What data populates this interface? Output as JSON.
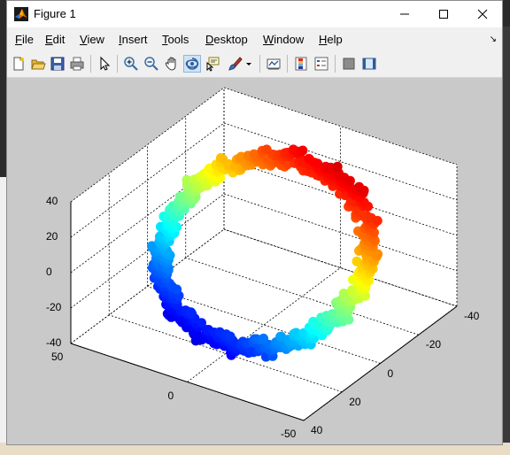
{
  "window": {
    "title": "Figure 1",
    "controls": {
      "minimize": "minimize",
      "maximize": "maximize",
      "close": "close"
    }
  },
  "menu": {
    "items": [
      {
        "label_first": "F",
        "label_rest": "ile"
      },
      {
        "label_first": "E",
        "label_rest": "dit"
      },
      {
        "label_first": "V",
        "label_rest": "iew"
      },
      {
        "label_first": "I",
        "label_rest": "nsert"
      },
      {
        "label_first": "T",
        "label_rest": "ools"
      },
      {
        "label_first": "D",
        "label_rest": "esktop"
      },
      {
        "label_first": "W",
        "label_rest": "indow"
      },
      {
        "label_first": "H",
        "label_rest": "elp"
      }
    ],
    "dock_arrow": "↘"
  },
  "toolbar": {
    "buttons": [
      "new-figure-icon",
      "open-file-icon",
      "save-icon",
      "print-icon",
      "edit-plot-icon",
      "zoom-in-icon",
      "zoom-out-icon",
      "pan-icon",
      "rotate-3d-icon",
      "data-cursor-icon",
      "brush-icon",
      "link-plot-icon",
      "colorbar-icon",
      "legend-icon",
      "hide-plot-tools-icon",
      "show-plot-tools-icon"
    ],
    "active": "rotate-3d-icon"
  },
  "chart_data": {
    "type": "scatter",
    "title": "",
    "xlabel": "",
    "ylabel": "",
    "zlabel": "",
    "colormap": "jet",
    "grid": true,
    "box": true,
    "x_ticks": [
      "-40",
      "-20",
      "0",
      "20",
      "40"
    ],
    "y_ticks": [
      "50",
      "0",
      "-50"
    ],
    "z_ticks": [
      "40",
      "20",
      "0",
      "-20",
      "-40"
    ],
    "xlim": [
      -40,
      40
    ],
    "ylim": [
      -50,
      50
    ],
    "zlim": [
      -40,
      40
    ],
    "ring": {
      "radius": 40,
      "tube_radius": 6,
      "tilt_deg": 30,
      "color_by": "z"
    }
  },
  "colors": {
    "figure_bg": "#c9c9c9",
    "axes_bg": "#ffffff",
    "menubar_bg": "#f0f0f0"
  }
}
